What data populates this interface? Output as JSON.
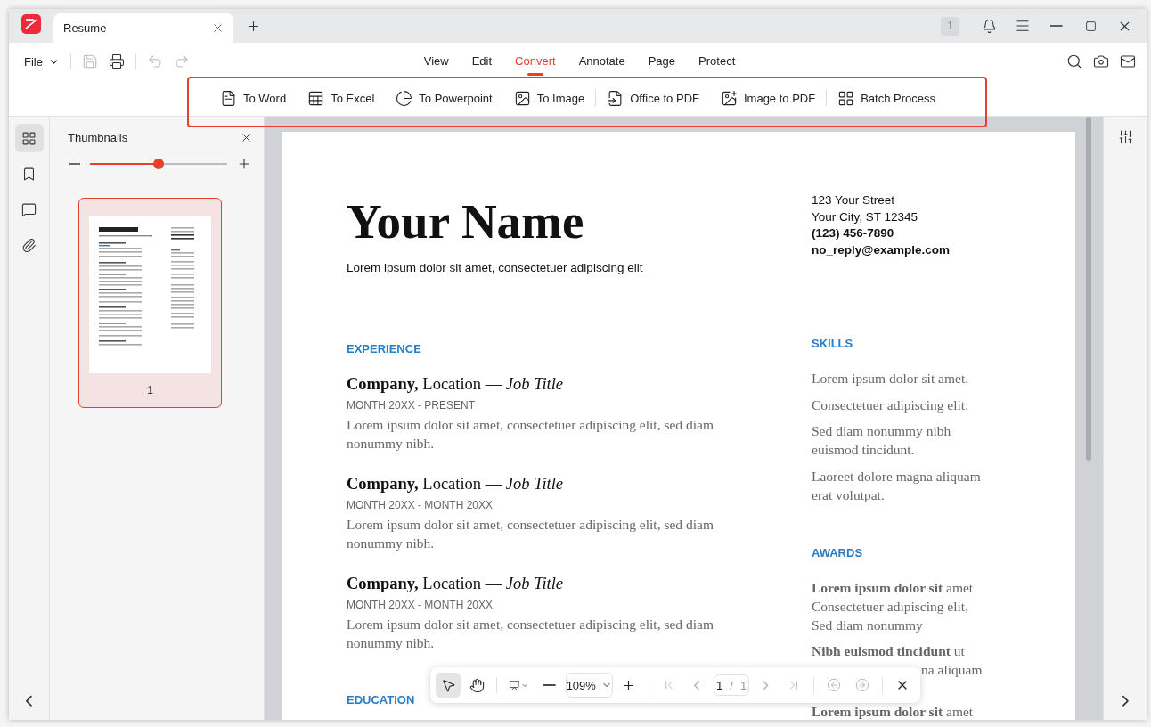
{
  "titlebar": {
    "tabs": [
      {
        "title": "Resume",
        "selected": true
      }
    ],
    "badge": "1"
  },
  "file_menu": "File",
  "quick_actions": [
    {
      "kind": "save",
      "disabled": true
    },
    {
      "kind": "print",
      "disabled": false
    },
    {
      "kind": "undo",
      "disabled": true
    },
    {
      "kind": "redo",
      "disabled": true
    }
  ],
  "menu_tabs": [
    {
      "label": "View",
      "selected": false
    },
    {
      "label": "Edit",
      "selected": false
    },
    {
      "label": "Convert",
      "selected": true
    },
    {
      "label": "Annotate",
      "selected": false
    },
    {
      "label": "Page",
      "selected": false
    },
    {
      "label": "Protect",
      "selected": false
    }
  ],
  "convert_tools": [
    {
      "label": "To Word",
      "kind": "word",
      "separator_before": false
    },
    {
      "label": "To Excel",
      "kind": "excel",
      "separator_before": false
    },
    {
      "label": "To Powerpoint",
      "kind": "powerpoint",
      "separator_before": false
    },
    {
      "label": "To Image",
      "kind": "image",
      "separator_before": false
    },
    {
      "label": "Office to PDF",
      "kind": "office",
      "separator_before": true
    },
    {
      "label": "Image to PDF",
      "kind": "image_pdf",
      "separator_before": false
    },
    {
      "label": "Batch Process",
      "kind": "batch",
      "separator_before": true
    }
  ],
  "sidebar": [
    {
      "kind": "thumbnails",
      "selected": true
    },
    {
      "kind": "bookmarks",
      "selected": false
    },
    {
      "kind": "comments",
      "selected": false
    },
    {
      "kind": "attachments",
      "selected": false
    }
  ],
  "thumbnails_panel": {
    "title": "Thumbnails",
    "level": 0.5,
    "pages": [
      {
        "label": "1",
        "selected": true
      }
    ]
  },
  "document": {
    "name": "Your Name",
    "tagline": "Lorem ipsum dolor sit amet, consectetuer adipiscing elit",
    "contact": [
      {
        "text": "123 Your Street",
        "bold": false
      },
      {
        "text": "Your City, ST 12345",
        "bold": false
      },
      {
        "text": "(123) 456-7890",
        "bold": true
      },
      {
        "text": "no_reply@example.com",
        "bold": true
      }
    ],
    "main_sections": [
      {
        "heading": "EXPERIENCE",
        "entries": [
          {
            "title": "**Company,** Location — *Job Title*",
            "dates": "MONTH 20XX - PRESENT",
            "description": "Lorem ipsum dolor sit amet, consectetuer adipiscing elit, sed diam nonummy nibh."
          },
          {
            "title": "**Company,** Location — *Job Title*",
            "dates": "MONTH 20XX - MONTH 20XX",
            "description": "Lorem ipsum dolor sit amet, consectetuer adipiscing elit, sed diam nonummy nibh."
          },
          {
            "title": "**Company,** Location — *Job Title*",
            "dates": "MONTH 20XX - MONTH 20XX",
            "description": "Lorem ipsum dolor sit amet, consectetuer adipiscing elit, sed diam nonummy nibh."
          }
        ]
      },
      {
        "heading": "EDUCATION"
      }
    ],
    "side_sections": [
      {
        "heading": "SKILLS",
        "items": [
          {
            "text": "Lorem ipsum dolor sit amet."
          },
          {
            "text": "Consectetuer adipiscing elit."
          },
          {
            "text": "Sed diam nonummy nibh euismod tincidunt."
          },
          {
            "text": "Laoreet dolore magna aliquam erat volutpat."
          }
        ]
      },
      {
        "heading": "AWARDS",
        "items": [
          {
            "text": "**Lorem ipsum dolor sit** amet Consectetuer adipiscing elit, Sed diam nonummy"
          },
          {
            "text": "**Nibh euismod tincidunt** ut",
            "continuation": "na aliquam"
          },
          {
            "text": "**Lorem ipsum dolor sit** amet"
          }
        ]
      }
    ]
  },
  "floating_toolbar": {
    "tools": [
      {
        "kind": "select",
        "selected": true
      },
      {
        "kind": "hand",
        "selected": false
      }
    ],
    "zoom": "109%",
    "current_page": "1",
    "page_separator": "/",
    "page_count": "1",
    "nav": [
      {
        "kind": "first",
        "disabled": true
      },
      {
        "kind": "previous",
        "disabled": true
      },
      {
        "kind": "next",
        "disabled": true
      },
      {
        "kind": "last",
        "disabled": true
      },
      {
        "kind": "back",
        "disabled": true
      },
      {
        "kind": "forward",
        "disabled": true
      }
    ]
  }
}
